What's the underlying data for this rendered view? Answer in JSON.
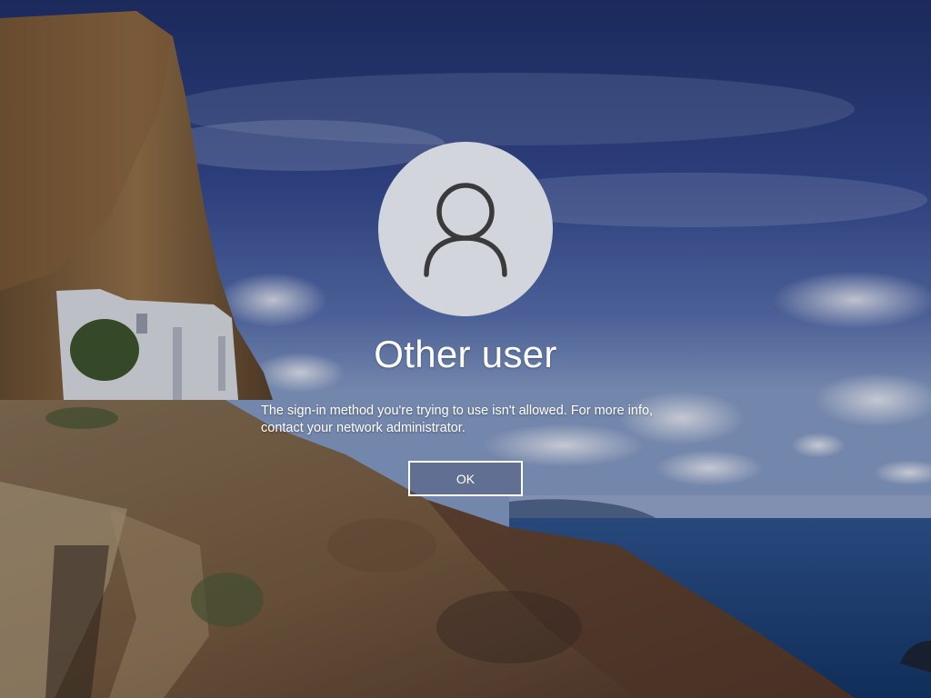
{
  "lock_screen": {
    "user_name": "Other user",
    "message": "The sign-in method you're trying to use isn't allowed. For more info, contact your network administrator.",
    "ok_label": "OK",
    "avatar_icon": "person-icon"
  },
  "colors": {
    "avatar_background": "#d3d5dd",
    "avatar_glyph": "#3a3a3a",
    "text": "#ffffff"
  }
}
